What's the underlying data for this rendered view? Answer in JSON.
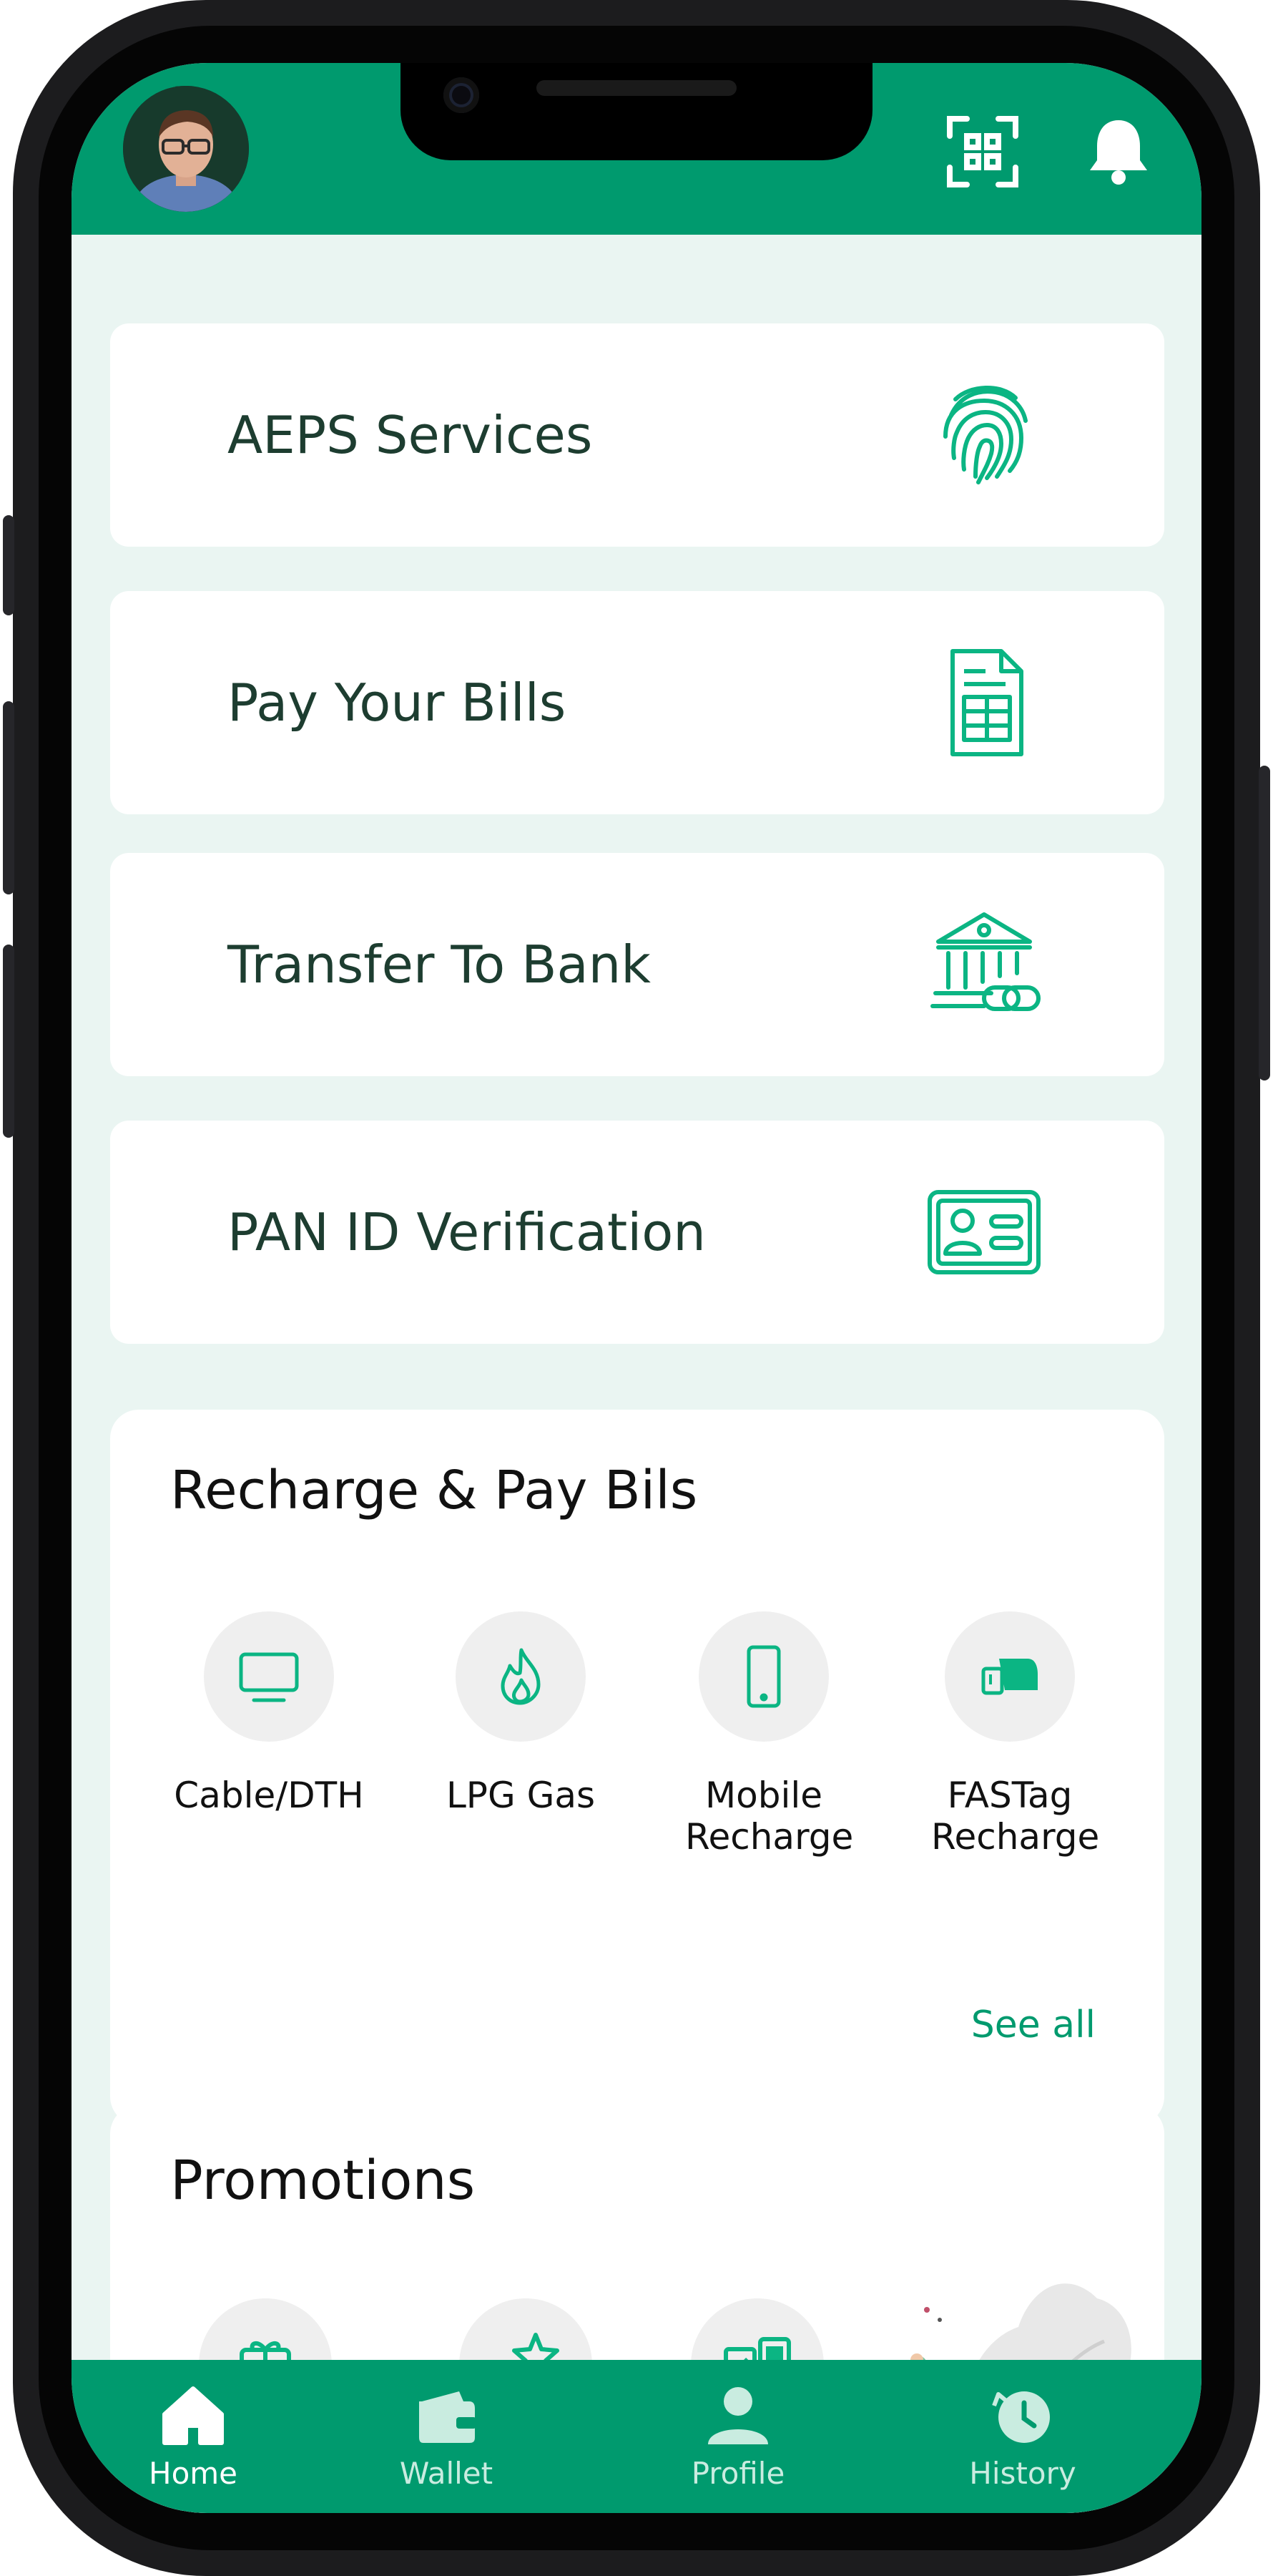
{
  "header": {
    "avatar_icon": "user-avatar",
    "scan_icon": "scan-qr-icon",
    "bell_icon": "bell-icon"
  },
  "services": [
    {
      "label": "AEPS Services",
      "icon": "fingerprint-icon"
    },
    {
      "label": "Pay Your Bills",
      "icon": "bill-document-icon"
    },
    {
      "label": "Transfer To Bank",
      "icon": "bank-link-icon"
    },
    {
      "label": "PAN ID Verification",
      "icon": "id-card-icon"
    }
  ],
  "recharge": {
    "title": "Recharge & Pay Bils",
    "items": [
      {
        "label": "Cable/DTH",
        "icon": "tv-icon"
      },
      {
        "label": "LPG Gas",
        "icon": "flame-icon"
      },
      {
        "label": "Mobile Recharge",
        "icon": "mobile-icon"
      },
      {
        "label": "FASTag Recharge",
        "icon": "fastag-icon"
      }
    ],
    "see_all": "See all"
  },
  "promotions": {
    "title": "Promotions",
    "icons": [
      "gift-icon",
      "offer-tag-icon",
      "transfer-phone-icon"
    ]
  },
  "bottom_nav": [
    {
      "label": "Home",
      "icon": "home-icon",
      "active": true
    },
    {
      "label": "Wallet",
      "icon": "wallet-icon",
      "active": false
    },
    {
      "label": "Profile",
      "icon": "profile-icon",
      "active": false
    },
    {
      "label": "History",
      "icon": "history-icon",
      "active": false
    }
  ],
  "colors": {
    "primary": "#009a6e",
    "background": "#eaf5f2",
    "card_text": "#1d3d30"
  }
}
